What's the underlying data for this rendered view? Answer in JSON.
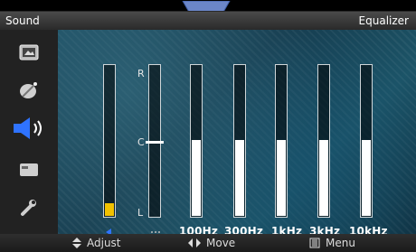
{
  "header": {
    "title": "Sound",
    "mode": "Equalizer"
  },
  "sidebar": {
    "items": [
      {
        "icon": "picture-icon"
      },
      {
        "icon": "satellite-dish-icon"
      },
      {
        "icon": "speaker-icon",
        "active": true
      },
      {
        "icon": "card-icon"
      },
      {
        "icon": "wrench-icon"
      }
    ]
  },
  "equalizer": {
    "balance_scale": {
      "top": "R",
      "center": "C",
      "bottom": "L"
    },
    "balance_level": 0.0,
    "bands": [
      {
        "label": "100Hz",
        "level": 0.5
      },
      {
        "label": "300Hz",
        "level": 0.5
      },
      {
        "label": "1kHz",
        "level": 0.5
      },
      {
        "label": "3kHz",
        "level": 0.5
      },
      {
        "label": "10kHz",
        "level": 0.5
      }
    ],
    "colors": {
      "band_fill": "#ffffff",
      "selected_bar_fill": "#f2c200",
      "accent": "#2f73ff"
    }
  },
  "footer": {
    "adjust": "Adjust",
    "move": "Move",
    "menu": "Menu"
  }
}
